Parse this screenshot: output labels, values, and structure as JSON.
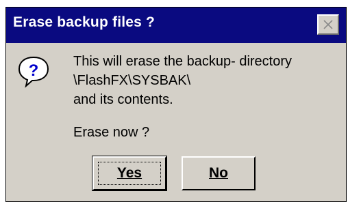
{
  "dialog": {
    "title": "Erase backup files ?",
    "close_icon": "close-icon",
    "icon": "question-icon",
    "message_lines": [
      "This will erase the backup- directory",
      "\\FlashFX\\SYSBAK\\",
      "and its contents."
    ],
    "prompt": "Erase now ?",
    "buttons": {
      "yes_label": "Yes",
      "no_label": "No"
    },
    "colors": {
      "titlebar": "#0a0a80",
      "face": "#d4d0c8"
    }
  }
}
